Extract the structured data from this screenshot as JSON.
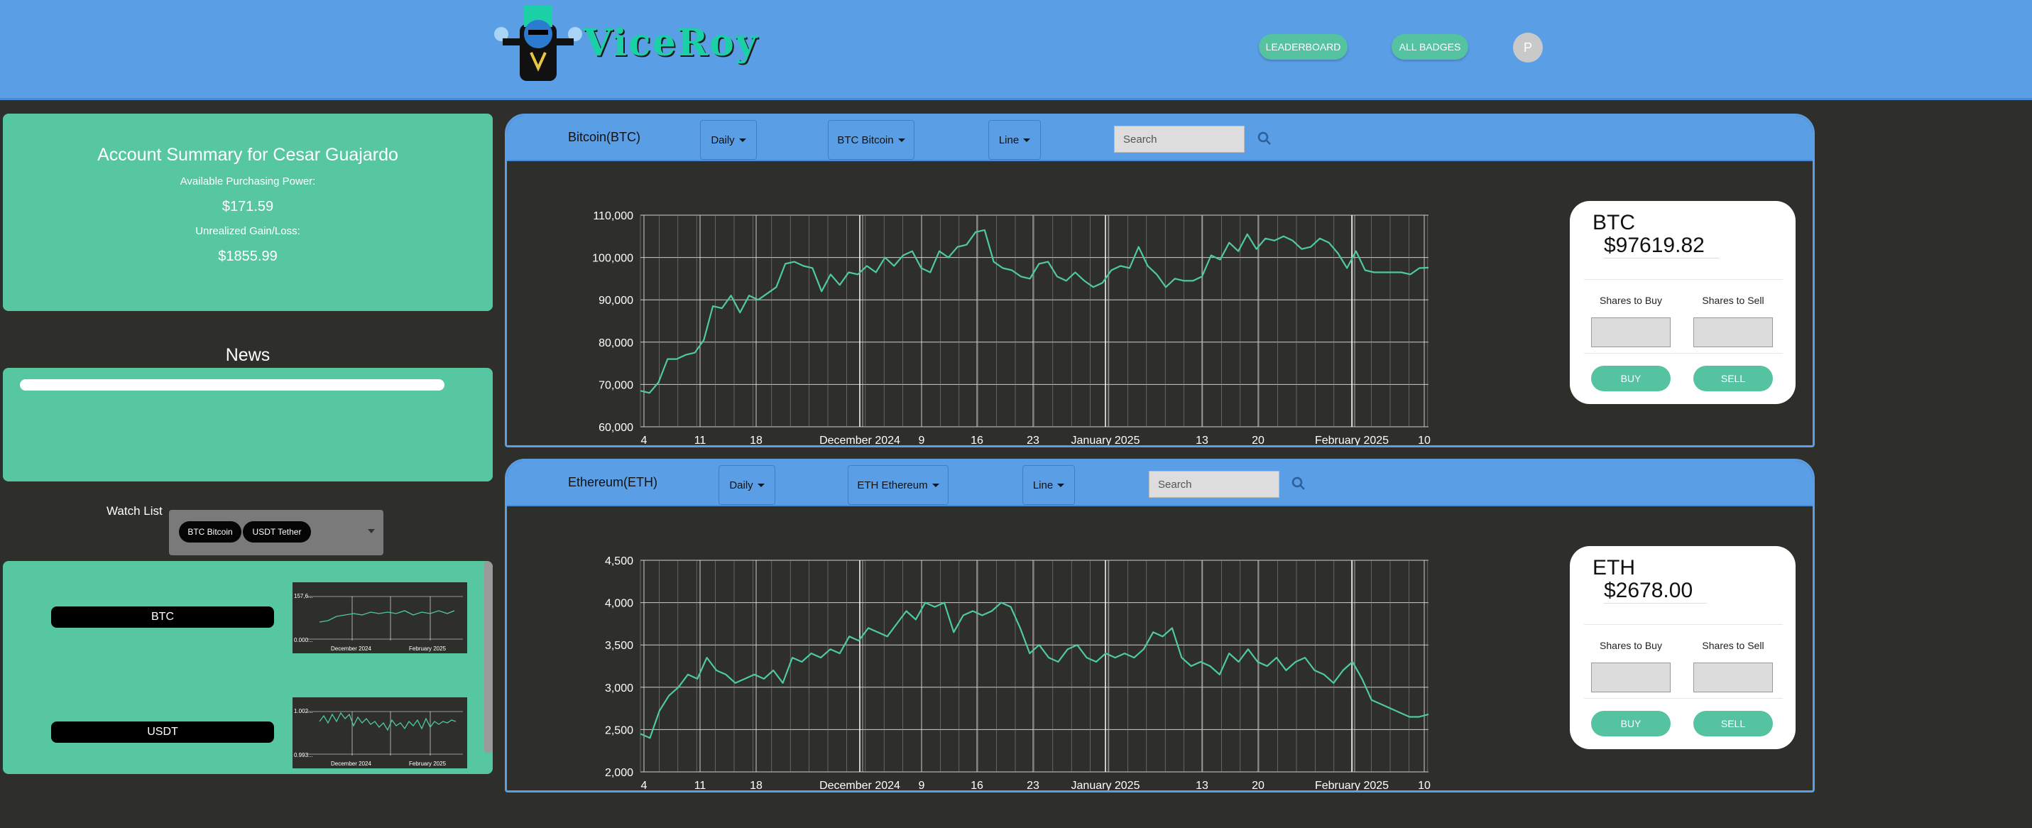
{
  "header": {
    "brand": "ViceRoy",
    "leaderboard_label": "LEADERBOARD",
    "badges_label": "ALL BADGES",
    "avatar_initial": "P"
  },
  "account": {
    "title": "Account Summary for Cesar Guajardo",
    "purchasing_label": "Available Purchasing Power:",
    "purchasing_value": "$171.59",
    "gain_label": "Unrealized Gain/Loss:",
    "gain_value": "$1855.99"
  },
  "news": {
    "title": "News"
  },
  "watchlist": {
    "label": "Watch List",
    "chips": [
      "BTC Bitcoin",
      "USDT Tether"
    ],
    "items": [
      {
        "ticker": "BTC",
        "ymax": "157,6...",
        "ymin": "0.000...",
        "xlabels": [
          "December 2024",
          "February 2025"
        ]
      },
      {
        "ticker": "USDT",
        "ymax": "1.002...",
        "ymin": "0.993...",
        "xlabels": [
          "December 2024",
          "February 2025"
        ]
      }
    ]
  },
  "coins": [
    {
      "name": "Bitcoin(BTC)",
      "interval": "Daily",
      "asset": "BTC Bitcoin",
      "chart_style": "Line",
      "search_placeholder": "Search",
      "symbol": "BTC",
      "price": "$97619.82",
      "buy_label": "Shares to Buy",
      "sell_label": "Shares to Sell",
      "buy_button": "BUY",
      "sell_button": "SELL"
    },
    {
      "name": "Ethereum(ETH)",
      "interval": "Daily",
      "asset": "ETH Ethereum",
      "chart_style": "Line",
      "search_placeholder": "Search",
      "symbol": "ETH",
      "price": "$2678.00",
      "buy_label": "Shares to Buy",
      "sell_label": "Shares to Sell",
      "buy_button": "BUY",
      "sell_button": "SELL"
    }
  ],
  "colors": {
    "line": "#4fc9a4",
    "header": "#5a9ee6",
    "panel": "#57c7a2",
    "background": "#2e2e2a"
  },
  "chart_data": [
    {
      "type": "line",
      "x_ticks": [
        "4",
        "11",
        "18",
        "December 2024",
        "9",
        "16",
        "23",
        "January 2025",
        "13",
        "20",
        "February 2025",
        "10"
      ],
      "y_ticks": [
        "60,000",
        "70,000",
        "80,000",
        "90,000",
        "100,000",
        "110,000"
      ],
      "ylim": [
        60000,
        110000
      ],
      "grid": true,
      "series": [
        {
          "values": [
            68500,
            68000,
            70500,
            76000,
            76000,
            77000,
            77500,
            80500,
            88500,
            88000,
            91000,
            87000,
            91000,
            90000,
            91500,
            93000,
            98500,
            99000,
            98000,
            97500,
            92000,
            96000,
            93500,
            96500,
            96000,
            98000,
            96500,
            100000,
            98000,
            100500,
            101500,
            97500,
            96500,
            101500,
            100000,
            102500,
            103000,
            106000,
            106500,
            99000,
            97500,
            97000,
            95500,
            95000,
            98500,
            99000,
            95500,
            94500,
            96500,
            94500,
            93000,
            94000,
            97000,
            98000,
            97500,
            102500,
            98000,
            96000,
            93000,
            95000,
            94500,
            94500,
            95500,
            100500,
            99500,
            103500,
            101500,
            105500,
            102000,
            104500,
            104000,
            105000,
            104000,
            102000,
            102500,
            104500,
            103500,
            101000,
            97500,
            101500,
            97000,
            96500,
            96500,
            96500,
            96500,
            96000,
            97500,
            97600
          ]
        }
      ]
    },
    {
      "type": "line",
      "x_ticks": [
        "4",
        "11",
        "18",
        "December 2024",
        "9",
        "16",
        "23",
        "January 2025",
        "13",
        "20",
        "February 2025",
        "10"
      ],
      "y_ticks": [
        "2,000",
        "2,500",
        "3,000",
        "3,500",
        "4,000",
        "4,500"
      ],
      "ylim": [
        2000,
        4500
      ],
      "grid": true,
      "series": [
        {
          "values": [
            2450,
            2400,
            2720,
            2900,
            3000,
            3150,
            3100,
            3350,
            3200,
            3150,
            3050,
            3100,
            3150,
            3100,
            3200,
            3050,
            3350,
            3300,
            3400,
            3350,
            3450,
            3400,
            3600,
            3550,
            3700,
            3650,
            3600,
            3750,
            3900,
            3800,
            4000,
            3950,
            4000,
            3650,
            3850,
            3900,
            3850,
            3900,
            4000,
            3950,
            3700,
            3400,
            3500,
            3350,
            3300,
            3450,
            3500,
            3350,
            3300,
            3400,
            3350,
            3400,
            3350,
            3450,
            3650,
            3600,
            3700,
            3350,
            3250,
            3300,
            3250,
            3150,
            3400,
            3300,
            3450,
            3300,
            3250,
            3350,
            3200,
            3300,
            3350,
            3200,
            3150,
            3050,
            3200,
            3300,
            3100,
            2850,
            2800,
            2750,
            2700,
            2650,
            2650,
            2680
          ]
        }
      ]
    }
  ]
}
